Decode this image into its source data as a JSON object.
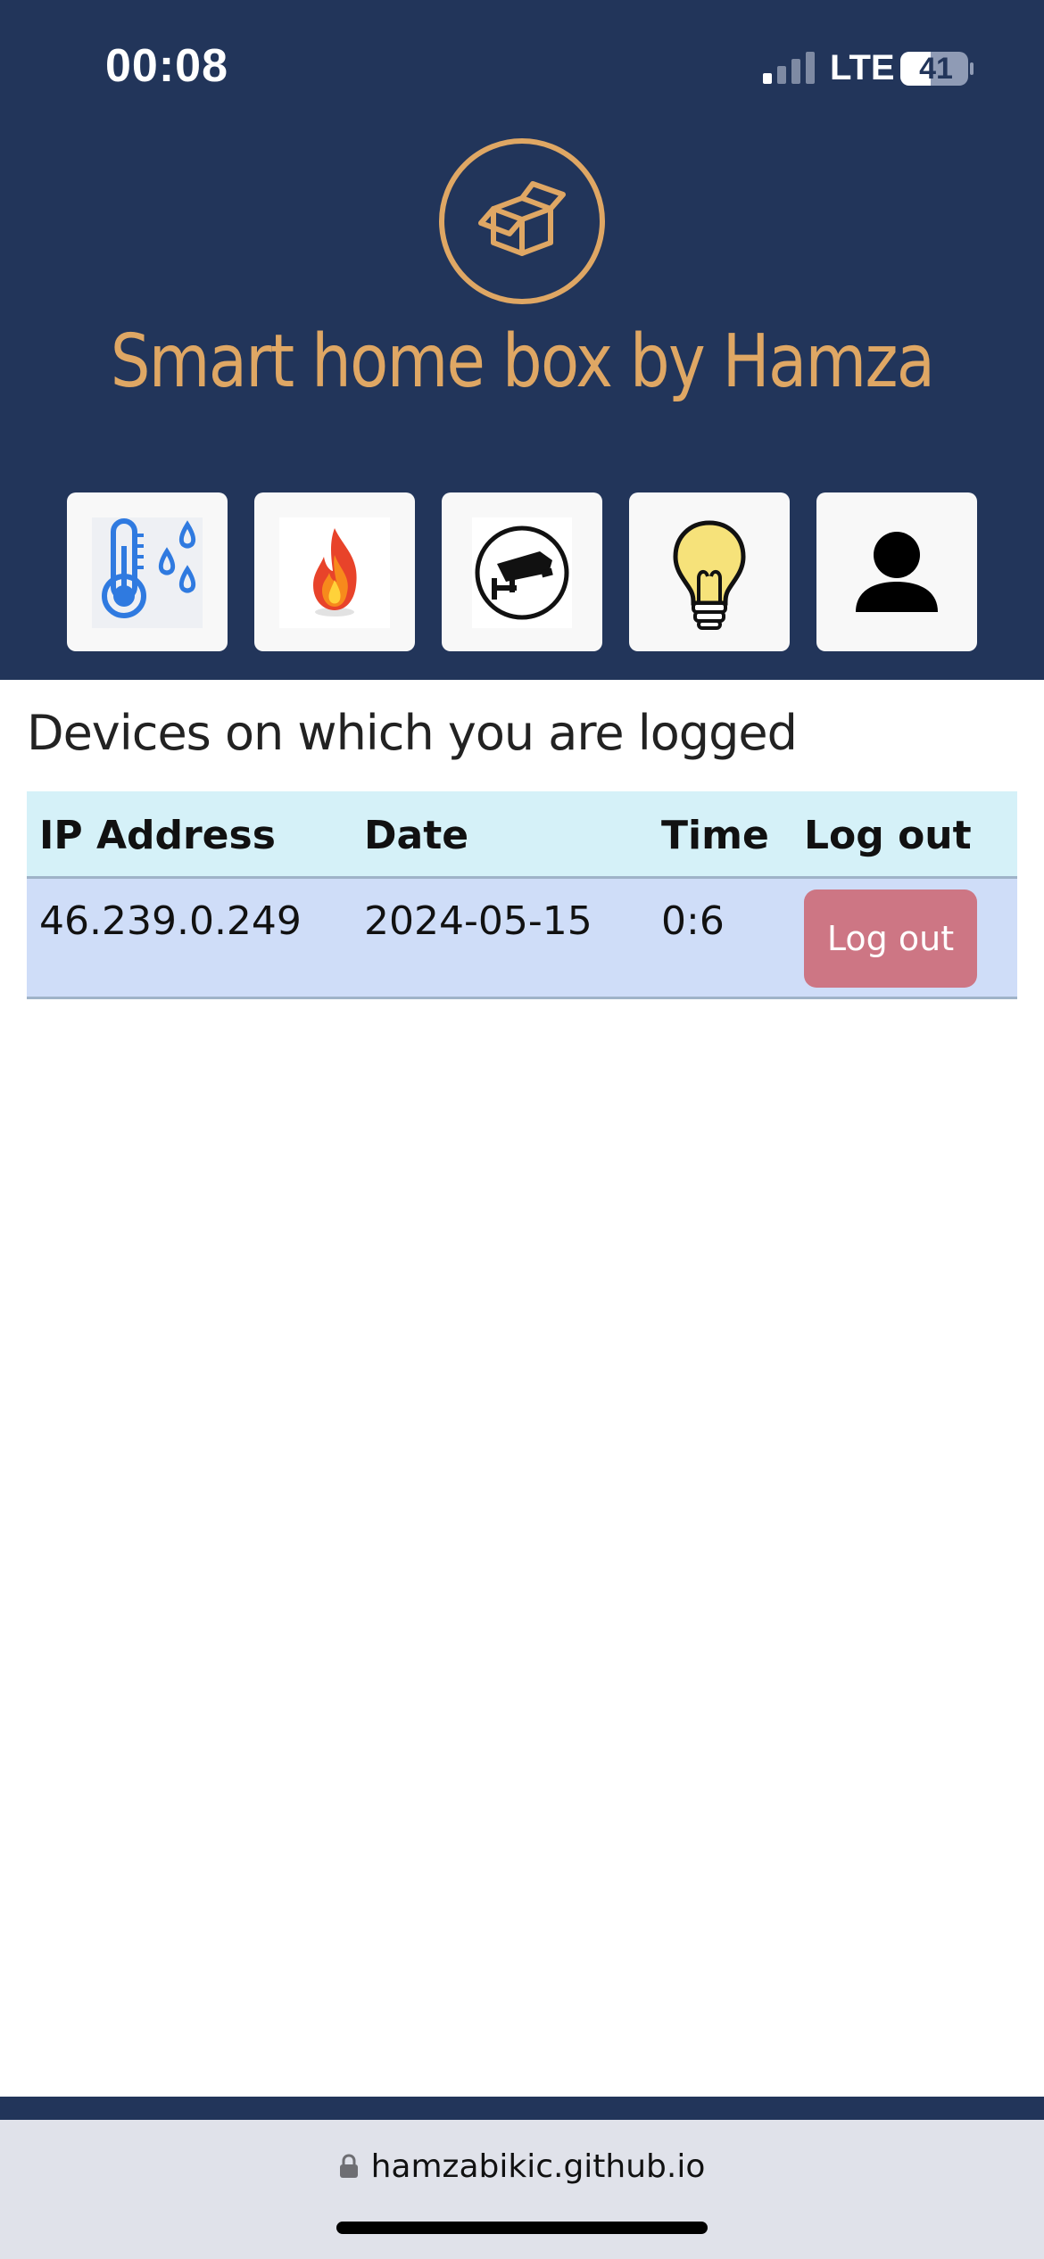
{
  "status_bar": {
    "time": "00:08",
    "network": "LTE",
    "battery": "41"
  },
  "header": {
    "logo_icon": "open-box-icon",
    "title": "Smart home box by Hamza",
    "accent_color": "#dfa764",
    "background_color": "#22355a"
  },
  "nav": [
    {
      "name": "temperature-humidity",
      "icon": "thermometer-drops-icon"
    },
    {
      "name": "fire",
      "icon": "flame-icon"
    },
    {
      "name": "camera",
      "icon": "security-camera-icon"
    },
    {
      "name": "light",
      "icon": "lightbulb-icon"
    },
    {
      "name": "profile",
      "icon": "person-icon"
    }
  ],
  "devices": {
    "title": "Devices on which you are logged",
    "columns": [
      "IP Address",
      "Date",
      "Time",
      "Log out"
    ],
    "rows": [
      {
        "ip": "46.239.0.249",
        "date": "2024-05-15",
        "time": "0:6",
        "action": "Log out"
      }
    ]
  },
  "browser": {
    "url": "hamzabikic.github.io"
  }
}
